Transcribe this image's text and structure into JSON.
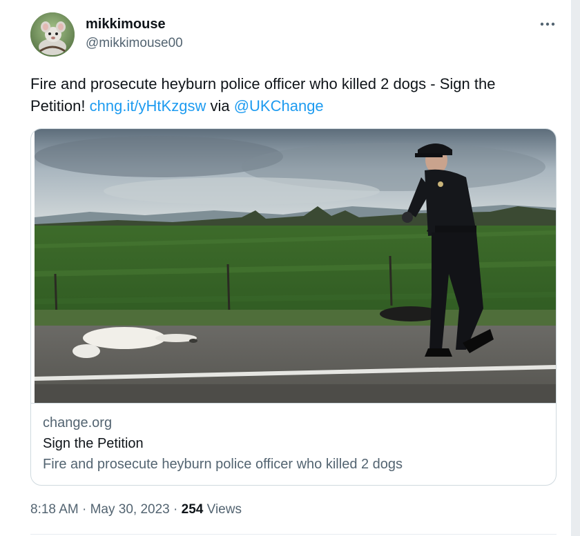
{
  "author": {
    "display_name": "mikkimouse",
    "handle": "@mikkimouse00"
  },
  "tweet": {
    "text": "Fire and prosecute heyburn police officer who killed 2 dogs - Sign the Petition! ",
    "link_text": "chng.it/yHtKzgsw",
    "via": " via ",
    "mention": "@UKChange"
  },
  "card": {
    "domain": "change.org",
    "title": "Sign the Petition",
    "description": "Fire and prosecute heyburn police officer who killed 2 dogs"
  },
  "meta": {
    "time": "8:18 AM",
    "separator_1": " · ",
    "date": "May 30, 2023",
    "separator_2": " · ",
    "views_count": "254",
    "views_label": " Views"
  },
  "icons": {
    "more": "more-icon"
  },
  "colors": {
    "link": "#1d9bf0",
    "text": "#0f1419",
    "secondary": "#536471",
    "border": "#cfd9de"
  }
}
